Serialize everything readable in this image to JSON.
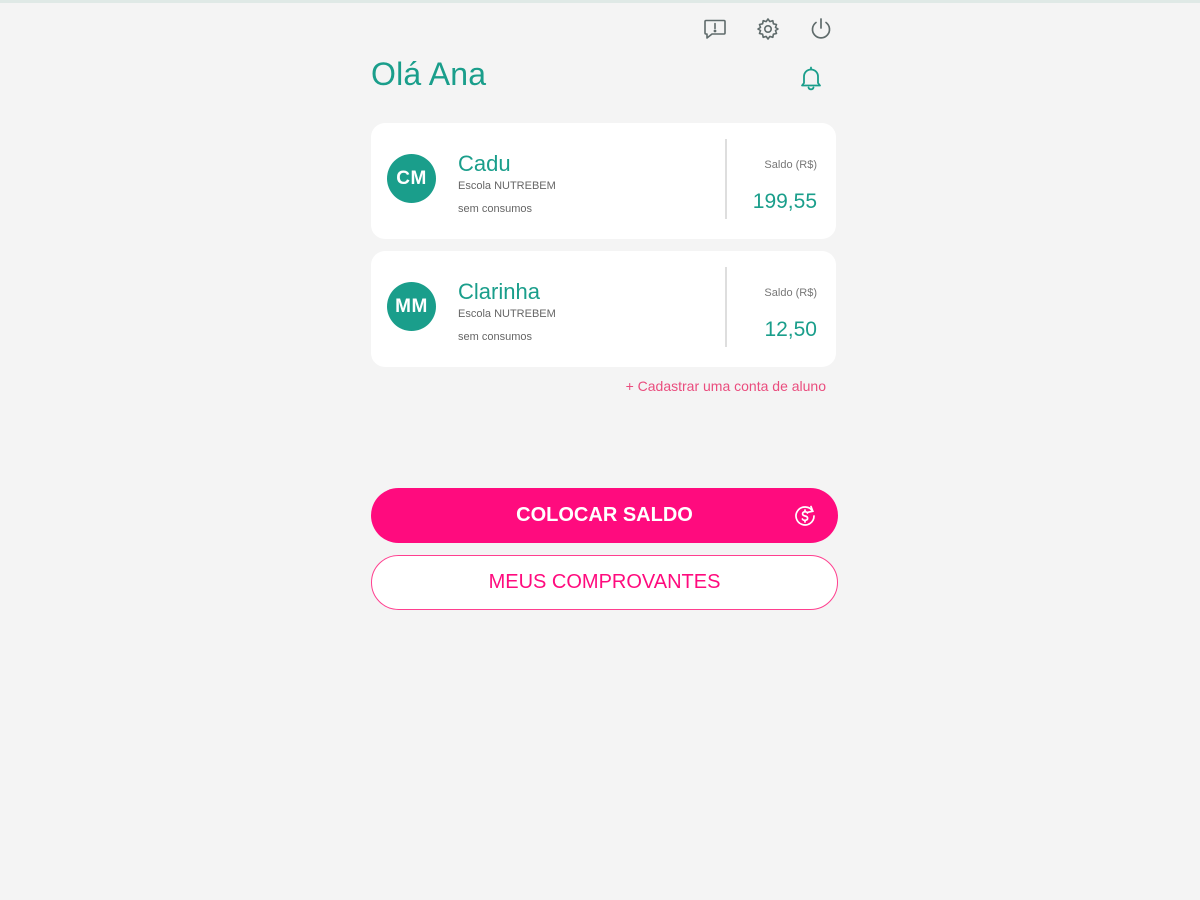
{
  "header": {
    "greeting": "Olá Ana",
    "icons": [
      "feedback-icon",
      "gear-icon",
      "power-icon",
      "bell-icon"
    ]
  },
  "students": [
    {
      "initials": "CM",
      "name": "Cadu",
      "school": "Escola NUTREBEM",
      "consumption": "sem consumos",
      "balance_label": "Saldo (R$)",
      "balance": "199,55"
    },
    {
      "initials": "MM",
      "name": "Clarinha",
      "school": "Escola NUTREBEM",
      "consumption": "sem consumos",
      "balance_label": "Saldo (R$)",
      "balance": "12,50"
    }
  ],
  "actions": {
    "add_student": "+ Cadastrar uma conta de aluno",
    "add_balance": "COLOCAR SALDO",
    "add_balance_icon": "coin-icon",
    "receipts": "MEUS COMPROVANTES"
  },
  "colors": {
    "teal": "#1a9e8b",
    "pink": "#ff0b7e",
    "background": "#f4f4f4"
  }
}
